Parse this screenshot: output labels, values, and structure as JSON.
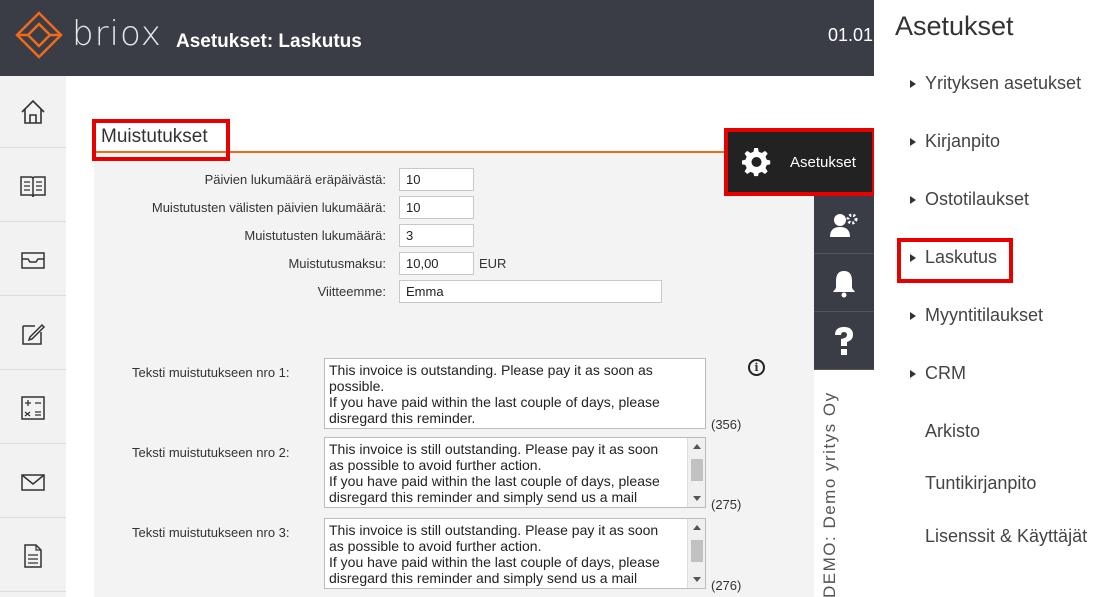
{
  "header": {
    "brand": "briox",
    "title": "Asetukset: Laskutus",
    "date": "01.01"
  },
  "left_nav": [
    "home-icon",
    "book-icon",
    "inbox-icon",
    "edit-icon",
    "calculator-icon",
    "mail-icon",
    "document-icon"
  ],
  "section": {
    "title": "Muistutukset"
  },
  "form": {
    "days_after_due": {
      "label": "Päivien lukumäärä eräpäivästä:",
      "value": "10"
    },
    "days_between": {
      "label": "Muistutusten välisten päivien lukumäärä:",
      "value": "10"
    },
    "reminder_count": {
      "label": "Muistutusten lukumäärä:",
      "value": "3"
    },
    "fee": {
      "label": "Muistutusmaksu:",
      "value": "10,00",
      "unit": "EUR"
    },
    "reference": {
      "label": "Viitteemme:",
      "value": "Emma"
    }
  },
  "texts": [
    {
      "label": "Teksti muistutukseen nro 1:",
      "lines": [
        "This invoice is outstanding. Please pay it as soon as",
        "possible.",
        "If you have paid within the last couple of days, please",
        "disregard this reminder."
      ],
      "count": "(356)"
    },
    {
      "label": "Teksti muistutukseen nro 2:",
      "lines": [
        "This invoice is still outstanding. Please pay it as soon",
        "as possible to avoid further action.",
        "If you have paid within the last couple of days, please",
        "disregard this reminder and simply send us a mail"
      ],
      "count": "(275)"
    },
    {
      "label": "Teksti muistutukseen nro 3:",
      "lines": [
        "This invoice is still outstanding. Please pay it as soon",
        "as possible to avoid further action.",
        "If you have paid within the last couple of days, please",
        "disregard this reminder and simply send us a mail"
      ],
      "count": "(276)"
    }
  ],
  "settings_button": {
    "label": "Asetukset"
  },
  "company": "DEMO: Demo yritys Oy",
  "right_menu": {
    "title": "Asetukset",
    "items": [
      {
        "label": "Yrityksen asetukset",
        "arrow": true
      },
      {
        "label": "Kirjanpito",
        "arrow": true
      },
      {
        "label": "Ostotilaukset",
        "arrow": true
      },
      {
        "label": "Laskutus",
        "arrow": true
      },
      {
        "label": "Myyntitilaukset",
        "arrow": true
      },
      {
        "label": "CRM",
        "arrow": true
      },
      {
        "label": "Arkisto",
        "arrow": false
      },
      {
        "label": "Tuntikirjanpito",
        "arrow": false
      },
      {
        "label": "Lisenssit & Käyttäjät",
        "arrow": false
      }
    ]
  },
  "colors": {
    "accent": "#f06a1c",
    "highlight": "#e60000",
    "topbar": "#3a3d45"
  }
}
